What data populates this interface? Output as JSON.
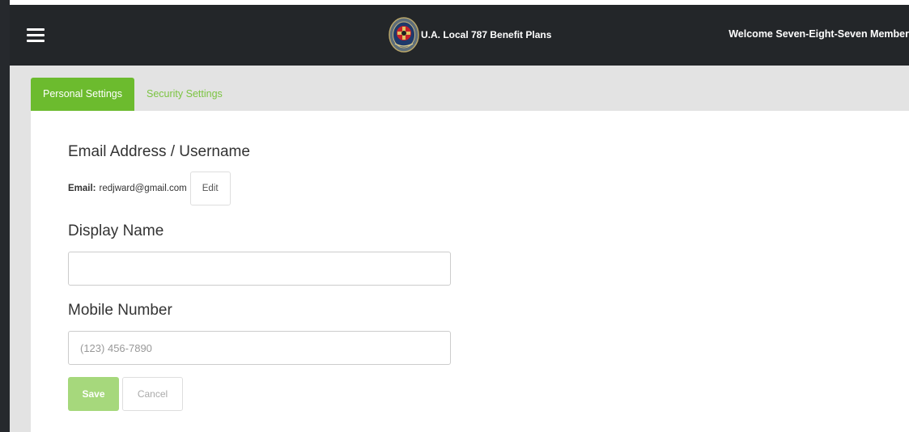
{
  "header": {
    "menu_icon": "hamburger-menu-icon",
    "logo_icon": "union-seal-logo-icon",
    "brand_name": "U.A. Local 787 Benefit Plans",
    "welcome_text": "Welcome Seven-Eight-Seven Member"
  },
  "tabs": [
    {
      "label": "Personal Settings",
      "active": true
    },
    {
      "label": "Security Settings",
      "active": false
    }
  ],
  "email_section": {
    "title": "Email Address / Username",
    "email_label": "Email:",
    "email_value": "redjward@gmail.com",
    "edit_label": "Edit"
  },
  "display_name_section": {
    "title": "Display Name",
    "value": "",
    "placeholder": ""
  },
  "mobile_section": {
    "title": "Mobile Number",
    "value": "",
    "placeholder": "(123) 456-7890"
  },
  "actions": {
    "save_label": "Save",
    "cancel_label": "Cancel"
  },
  "colors": {
    "topbar": "#232629",
    "accent_green": "#6cbb2e",
    "tab_inactive_text": "#7cc442",
    "save_disabled": "#a6d87c",
    "content_background": "#e3e3e3"
  }
}
